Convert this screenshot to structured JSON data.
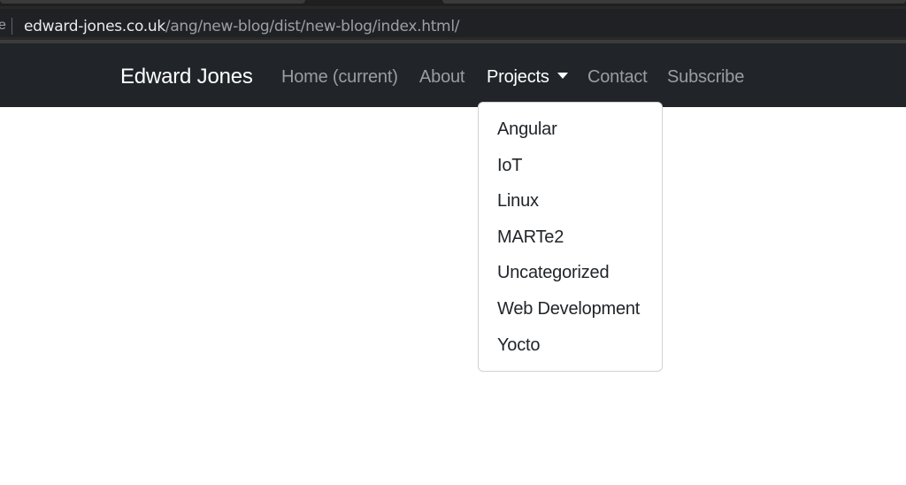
{
  "browser": {
    "url_prefix": "e",
    "url_host": "edward-jones.co.uk",
    "url_path": "/ang/new-blog/dist/new-blog/index.html/"
  },
  "navbar": {
    "brand": "Edward Jones",
    "links": [
      {
        "label": "Home (current)"
      },
      {
        "label": "About"
      },
      {
        "label": "Projects"
      },
      {
        "label": "Contact"
      },
      {
        "label": "Subscribe"
      }
    ]
  },
  "dropdown": {
    "items": [
      {
        "label": "Angular"
      },
      {
        "label": "IoT"
      },
      {
        "label": "Linux"
      },
      {
        "label": "MARTe2"
      },
      {
        "label": "Uncategorized"
      },
      {
        "label": "Web Development"
      },
      {
        "label": "Yocto"
      }
    ]
  },
  "colors": {
    "navbar_bg": "#212529",
    "nav_link": "#9a9da1",
    "nav_active": "#ffffff",
    "dropdown_text": "#212529"
  }
}
